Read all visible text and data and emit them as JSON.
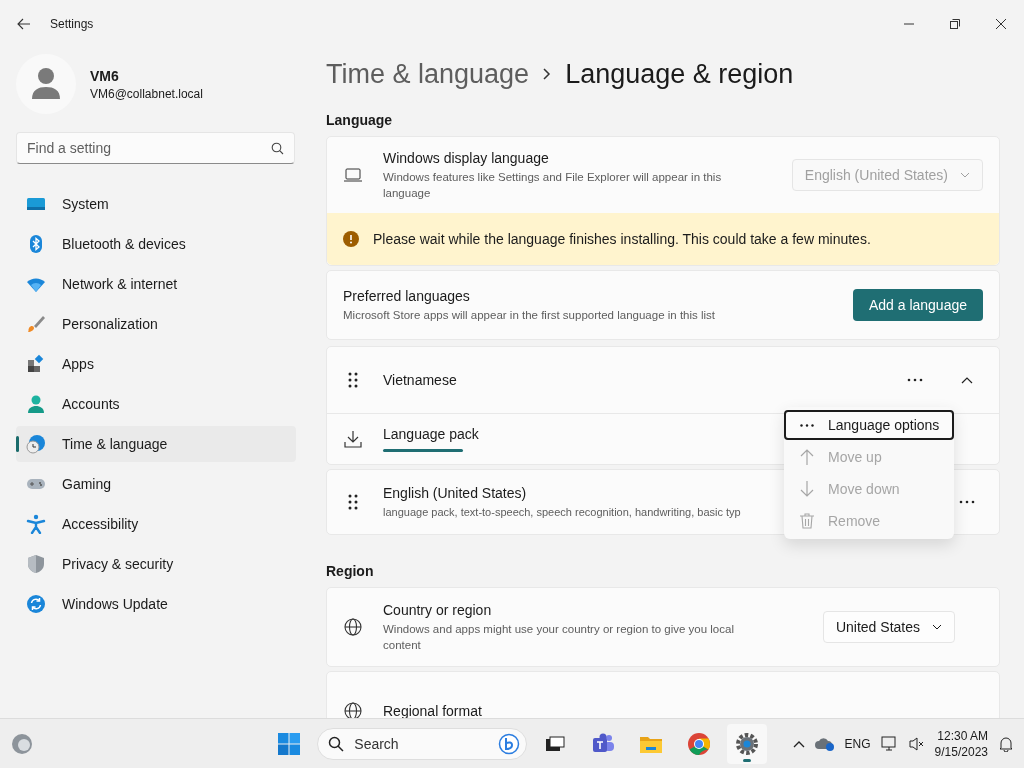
{
  "window": {
    "title": "Settings"
  },
  "user": {
    "name": "VM6",
    "email": "VM6@collabnet.local"
  },
  "search": {
    "placeholder": "Find a setting"
  },
  "nav": [
    {
      "label": "System",
      "selected": false
    },
    {
      "label": "Bluetooth & devices",
      "selected": false
    },
    {
      "label": "Network & internet",
      "selected": false
    },
    {
      "label": "Personalization",
      "selected": false
    },
    {
      "label": "Apps",
      "selected": false
    },
    {
      "label": "Accounts",
      "selected": false
    },
    {
      "label": "Time & language",
      "selected": true
    },
    {
      "label": "Gaming",
      "selected": false
    },
    {
      "label": "Accessibility",
      "selected": false
    },
    {
      "label": "Privacy & security",
      "selected": false
    },
    {
      "label": "Windows Update",
      "selected": false
    }
  ],
  "breadcrumb": {
    "parent": "Time & language",
    "current": "Language & region"
  },
  "language": {
    "heading": "Language",
    "display_language": {
      "title": "Windows display language",
      "description": "Windows features like Settings and File Explorer will appear in this language",
      "value": "English (United States)",
      "disabled": true
    },
    "notice": "Please wait while the language finishes installing. This could take a few minutes.",
    "preferred": {
      "title": "Preferred languages",
      "description": "Microsoft Store apps will appear in the first supported language in this list",
      "button": "Add a language"
    },
    "languages": [
      {
        "name": "Vietnamese",
        "expanded": true,
        "pack": {
          "label": "Language pack",
          "installing": true
        }
      },
      {
        "name": "English (United States)",
        "description": "language pack, text-to-speech, speech recognition, handwriting, basic typ",
        "expanded": false
      }
    ]
  },
  "menu": [
    {
      "label": "Language options",
      "disabled": false,
      "focused": true
    },
    {
      "label": "Move up",
      "disabled": true,
      "focused": false
    },
    {
      "label": "Move down",
      "disabled": true,
      "focused": false
    },
    {
      "label": "Remove",
      "disabled": true,
      "focused": false
    }
  ],
  "region": {
    "heading": "Region",
    "rows": [
      {
        "title": "Country or region",
        "description": "Windows and apps might use your country or region to give you local content",
        "value": "United States"
      },
      {
        "title": "Regional format"
      }
    ]
  },
  "taskbar": {
    "search": "Search",
    "language": "ENG",
    "time": "12:30 AM",
    "date": "9/15/2023"
  }
}
